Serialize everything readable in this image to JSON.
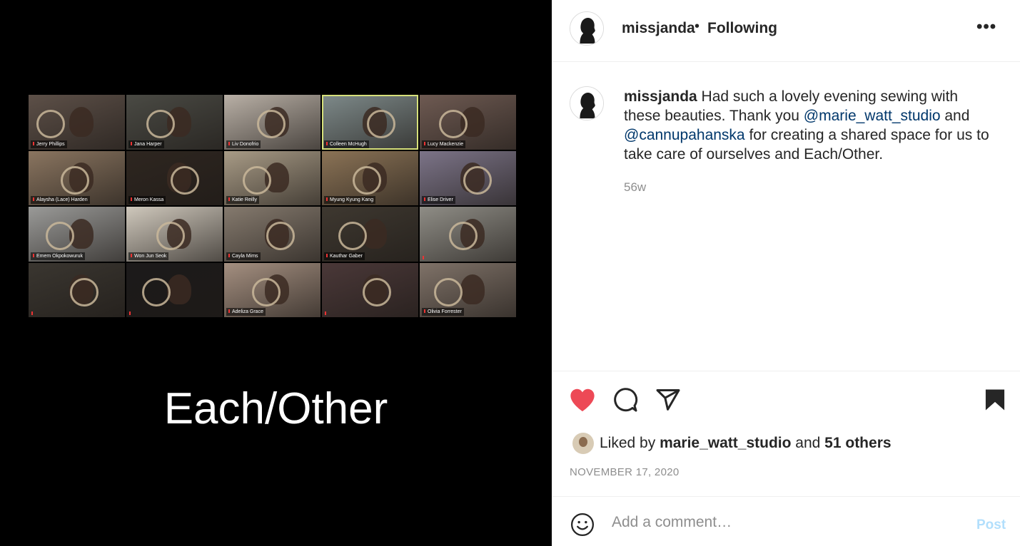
{
  "media": {
    "caption": "Each/Other",
    "participants": [
      {
        "name": "Jerry Phillips",
        "bg": "#5d5048",
        "active": false
      },
      {
        "name": "Jana Harper",
        "bg": "#4a4a44",
        "active": false
      },
      {
        "name": "Liv Donofrio",
        "bg": "#b9b0a6",
        "active": false
      },
      {
        "name": "Colleen McHugh",
        "bg": "#7e8a8a",
        "active": true
      },
      {
        "name": "Lucy Mackenzie",
        "bg": "#6e5a52",
        "active": false
      },
      {
        "name": "Alaysha (Lace) Harden",
        "bg": "#8a7560",
        "active": false
      },
      {
        "name": "Meron Kassa",
        "bg": "#2e2620",
        "active": false
      },
      {
        "name": "Katie Reilly",
        "bg": "#a89b86",
        "active": false
      },
      {
        "name": "Myung Kyung Kang",
        "bg": "#8b7356",
        "active": false
      },
      {
        "name": "Elise Driver",
        "bg": "#7c7488",
        "active": false
      },
      {
        "name": "Emem Okpokowuruk",
        "bg": "#9a9a98",
        "active": false
      },
      {
        "name": "Won Jun Seok",
        "bg": "#cfc8bc",
        "active": false
      },
      {
        "name": "Cayla Mims",
        "bg": "#857a6e",
        "active": false
      },
      {
        "name": "Kauthar Gaber",
        "bg": "#3e3830",
        "active": false
      },
      {
        "name": "",
        "bg": "#8f8d86",
        "active": false
      },
      {
        "name": "",
        "bg": "#3a3630",
        "active": false
      },
      {
        "name": "",
        "bg": "#1c1a1a",
        "active": false
      },
      {
        "name": "Adeliza Grace",
        "bg": "#a48f80",
        "active": false
      },
      {
        "name": "",
        "bg": "#4a3838",
        "active": false
      },
      {
        "name": "Olivia Forrester",
        "bg": "#7f7268",
        "active": false
      }
    ]
  },
  "header": {
    "username": "missjanda",
    "separator": "•",
    "follow_status": "Following",
    "more": "•••"
  },
  "caption": {
    "username": "missjanda",
    "text_1": " Had such a lovely evening sewing with these beauties. Thank you ",
    "mention_1": "@marie_watt_studio",
    "text_2": " and ",
    "mention_2": "@cannupahanska",
    "text_3": " for creating a shared space for us to take care of ourselves and Each/Other.",
    "age": "56w"
  },
  "actions": {
    "liked_prefix": "Liked by ",
    "liked_user": "marie_watt_studio",
    "liked_middle": " and ",
    "liked_others": "51 others",
    "date": "NOVEMBER 17, 2020",
    "like_color": "#ed4956"
  },
  "comment": {
    "placeholder": "Add a comment…",
    "post_label": "Post"
  }
}
